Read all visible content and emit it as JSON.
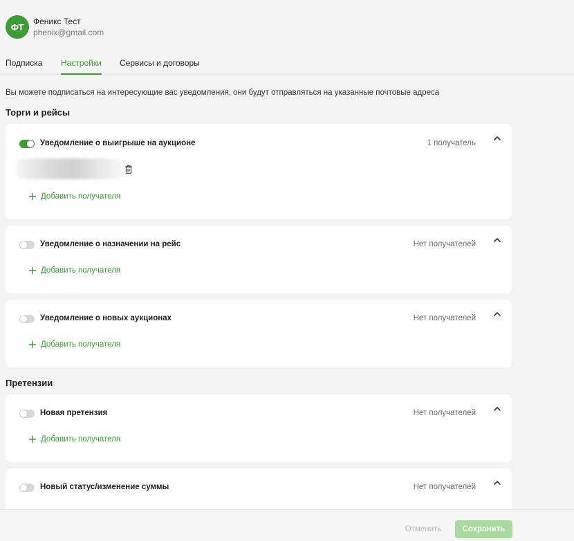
{
  "user": {
    "initials": "ФТ",
    "name": "Феникс Тест",
    "email": "phenix@gmail.com"
  },
  "tabs": [
    {
      "label": "Подписка"
    },
    {
      "label": "Настройки",
      "active": true
    },
    {
      "label": "Сервисы и договоры"
    }
  ],
  "info_text": "Вы можете подписаться на интересующие вас уведомления, они будут отправляться на указанные почтовые адреса",
  "sections": [
    {
      "title": "Торги и рейсы",
      "cards": [
        {
          "title": "Уведомление о выигрыше на аукционе",
          "count": "1 получатель",
          "enabled": true,
          "add_label": "Добавить получателя"
        },
        {
          "title": "Уведомление о назначении на рейс",
          "count": "Нет получателей",
          "enabled": false,
          "add_label": "Добавить получателя"
        },
        {
          "title": "Уведомление о новых аукционах",
          "count": "Нет получателей",
          "enabled": false,
          "add_label": "Добавить получателя"
        }
      ]
    },
    {
      "title": "Претензии",
      "cards": [
        {
          "title": "Новая претензия",
          "count": "Нет получателей",
          "enabled": false,
          "add_label": "Добавить получателя"
        },
        {
          "title": "Новый статус/изменение суммы",
          "count": "Нет получателей",
          "enabled": false
        }
      ]
    }
  ],
  "footer": {
    "cancel_label": "Отменить",
    "save_label": "Сохранить"
  },
  "colors": {
    "accent": "#3f9a3a",
    "save_disabled": "#a9d99f"
  }
}
